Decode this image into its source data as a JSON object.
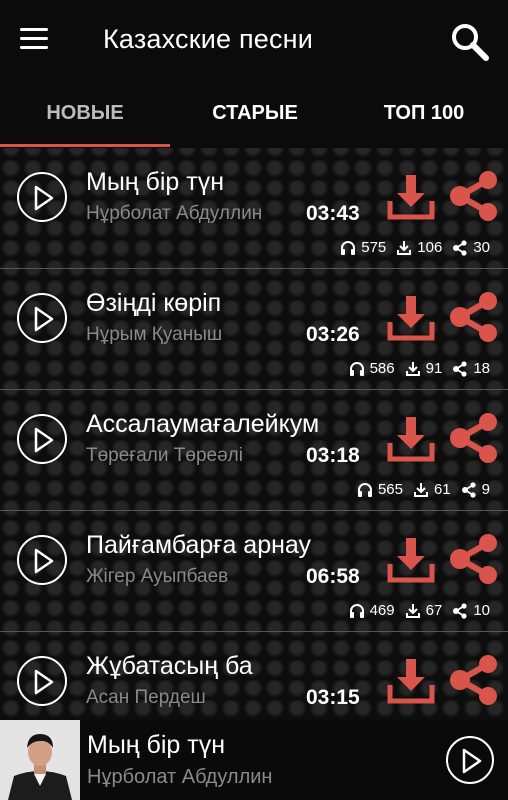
{
  "header": {
    "title": "Казахские песни",
    "menu_icon": "hamburger-menu-icon",
    "search_icon": "search-icon"
  },
  "tabs": [
    {
      "label": "НОВЫЕ",
      "active": true
    },
    {
      "label": "СТАРЫЕ",
      "active": false
    },
    {
      "label": "ТОП 100",
      "active": false
    }
  ],
  "colors": {
    "accent": "#d9544a",
    "background": "#0d0d0d",
    "artist_text": "#8a8a8a"
  },
  "songs": [
    {
      "title": "Мың бір түн",
      "artist": "Нұрболат Абдуллин",
      "duration": "03:43",
      "listens": "575",
      "downloads": "106",
      "shares": "30"
    },
    {
      "title": "Өзіңді көріп",
      "artist": "Нұрым Қуаныш",
      "duration": "03:26",
      "listens": "586",
      "downloads": "91",
      "shares": "18"
    },
    {
      "title": "Ассалаумағалейкум",
      "artist": "Төреғали Төреәлі",
      "duration": "03:18",
      "listens": "565",
      "downloads": "61",
      "shares": "9"
    },
    {
      "title": "Пайғамбарға арнау",
      "artist": "Жігер Ауыпбаев",
      "duration": "06:58",
      "listens": "469",
      "downloads": "67",
      "shares": "10"
    },
    {
      "title": "Жұбатасың ба",
      "artist": "Асан Пердеш",
      "duration": "03:15",
      "listens": "",
      "downloads": "",
      "shares": ""
    }
  ],
  "player": {
    "title": "Мың бір түн",
    "artist": "Нұрболат Абдуллин",
    "play_icon": "play-icon"
  }
}
